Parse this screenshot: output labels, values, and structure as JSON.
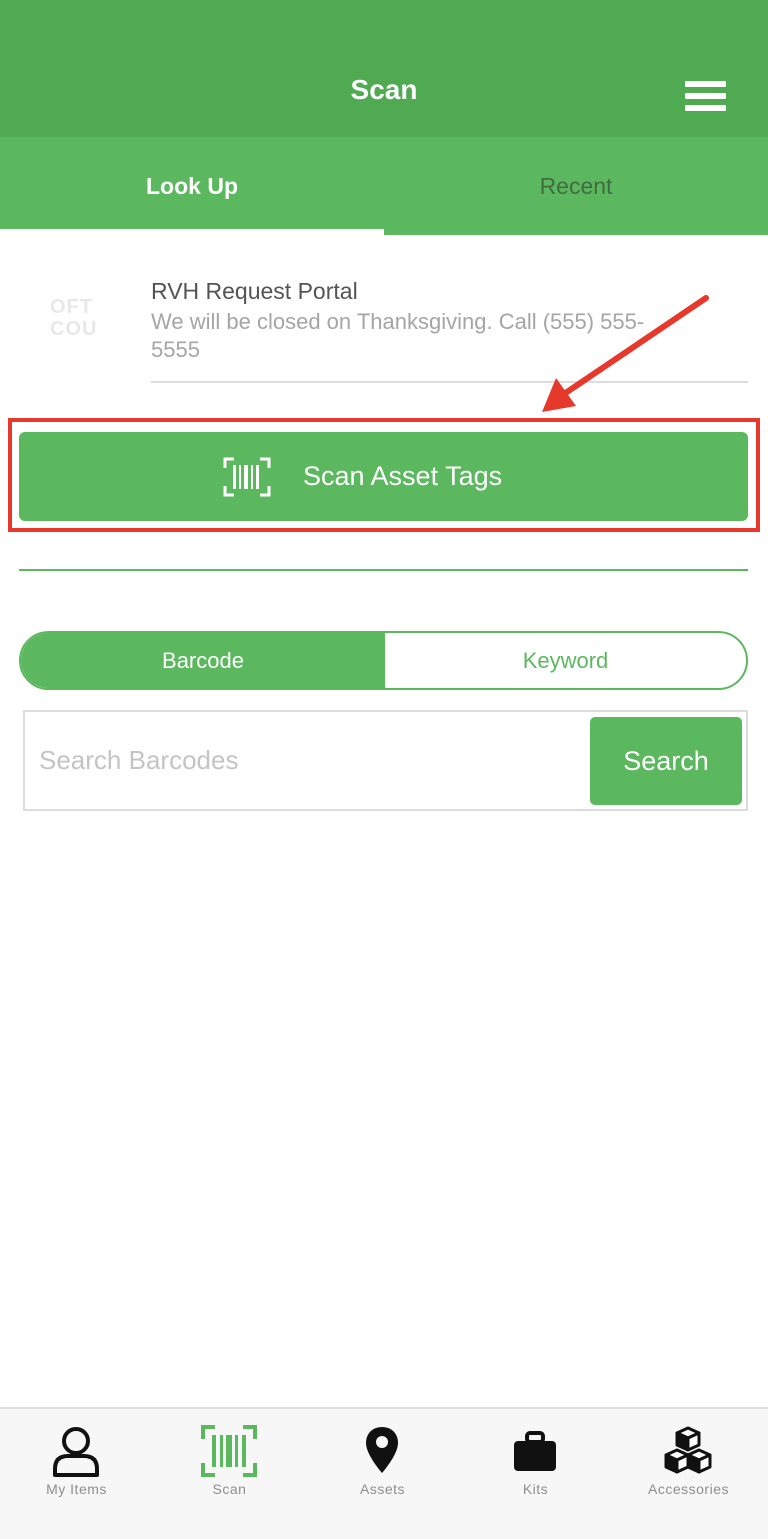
{
  "header": {
    "title": "Scan"
  },
  "tabs": [
    {
      "label": "Look Up"
    },
    {
      "label": "Recent"
    }
  ],
  "portal": {
    "logo_text": "OFT COU",
    "title": "RVH Request Portal",
    "message": "We will be closed on Thanksgiving. Call (555) 555-5555"
  },
  "scan_button": {
    "label": "Scan Asset Tags",
    "icon": "barcode-scan-icon"
  },
  "search_mode": {
    "options": [
      {
        "label": "Barcode"
      },
      {
        "label": "Keyword"
      }
    ],
    "selected": "Barcode"
  },
  "search": {
    "placeholder": "Search Barcodes",
    "value": "",
    "button_label": "Search"
  },
  "bottom_nav": [
    {
      "label": "My Items",
      "icon": "person-icon"
    },
    {
      "label": "Scan",
      "icon": "barcode-scan-icon",
      "active": true
    },
    {
      "label": "Assets",
      "icon": "map-pin-icon"
    },
    {
      "label": "Kits",
      "icon": "briefcase-icon"
    },
    {
      "label": "Accessories",
      "icon": "boxes-icon"
    }
  ],
  "colors": {
    "header": "#4faa52",
    "primary": "#5cb85f",
    "highlight": "#e6392c"
  }
}
